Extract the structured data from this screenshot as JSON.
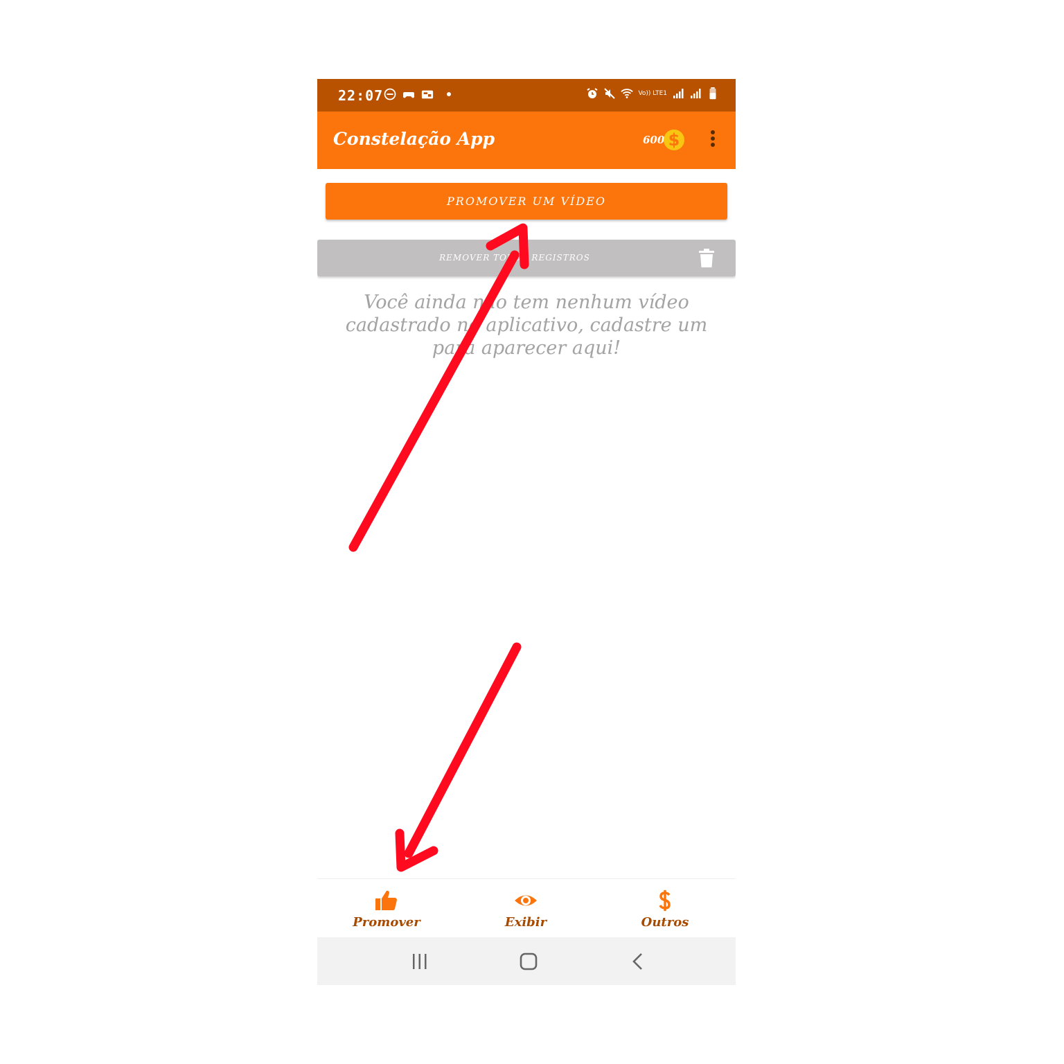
{
  "status_bar": {
    "time": "22:07",
    "network_label": "Vo)) LTE1"
  },
  "app_bar": {
    "title": "Constelação App",
    "coins": "600",
    "coin_symbol": "$"
  },
  "main": {
    "promote_button": "PROMOVER UM VÍDEO",
    "remove_button": "REMOVER TODOS REGISTROS",
    "empty_message": "Você ainda não tem nenhum vídeo cadastrado no aplicativo, cadastre um para aparecer aqui!"
  },
  "bottom_nav": {
    "items": [
      {
        "label": "Promover",
        "icon": "thumbs-up-icon"
      },
      {
        "label": "Exibir",
        "icon": "eye-icon"
      },
      {
        "label": "Outros",
        "icon": "dollar-icon"
      }
    ]
  },
  "colors": {
    "primary": "#fc750c",
    "status_bar": "#b85200",
    "nav_label": "#a64a00",
    "remove_bar": "#c1bfbf",
    "annotation_arrow": "#ff0a1e",
    "coin": "#f9c513"
  }
}
